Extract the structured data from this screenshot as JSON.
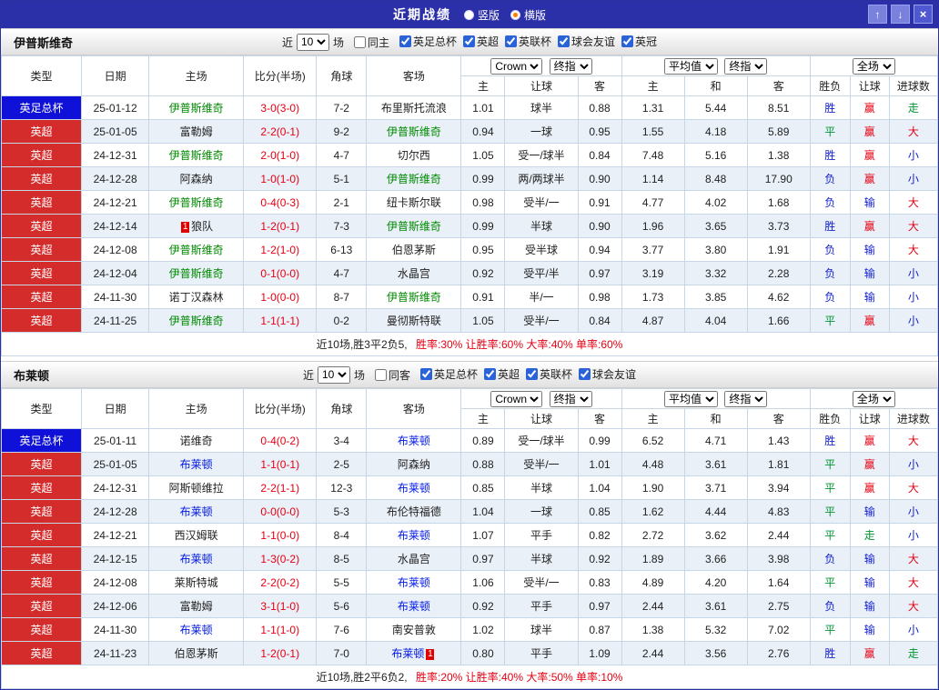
{
  "topbar": {
    "title": "近期战绩",
    "view_options": [
      {
        "label": "竖版",
        "selected": false
      },
      {
        "label": "横版",
        "selected": true
      }
    ],
    "up_icon": "↑",
    "down_icon": "↓",
    "close_icon": "×"
  },
  "labels": {
    "near": "近",
    "games": "场"
  },
  "table_header": {
    "left_cols": [
      "类型",
      "日期",
      "主场",
      "比分(半场)",
      "角球",
      "客场"
    ],
    "bookmaker": "Crown",
    "odds_type": "终指",
    "euro_source": "平均值",
    "euro_odds_type": "终指",
    "scope": "全场",
    "asia_sub": [
      "主",
      "让球",
      "客"
    ],
    "euro_sub": [
      "主",
      "和",
      "客"
    ],
    "result_sub": [
      "胜负",
      "让球",
      "进球数"
    ]
  },
  "colors": {
    "cup_badge": "#0f10d8",
    "league_badge": "#d42b2b",
    "red": "#e60012",
    "blue": "#1421cf",
    "green": "#009532"
  },
  "sections": [
    {
      "team": "伊普斯维奇",
      "team_color": "#008a00",
      "filter": {
        "count": "10",
        "same_label": "同主",
        "same_checked": false,
        "competitions": [
          "英足总杯",
          "英超",
          "英联杯",
          "球会友谊",
          "英冠"
        ]
      },
      "rows": [
        {
          "type": "英足总杯",
          "type_style": "cup",
          "date": "25-01-12",
          "home": "伊普斯维奇",
          "home_hl": true,
          "score": "3-0(3-0)",
          "corner": "7-2",
          "away": "布里斯托流浪",
          "away_hl": false,
          "red_card": null,
          "asia": [
            "1.01",
            "球半",
            "0.88"
          ],
          "euro": [
            "1.31",
            "5.44",
            "8.51"
          ],
          "result": [
            [
              "胜",
              "blue"
            ],
            [
              "赢",
              "red"
            ],
            [
              "走",
              "green"
            ]
          ]
        },
        {
          "type": "英超",
          "type_style": "league",
          "date": "25-01-05",
          "home": "富勒姆",
          "home_hl": false,
          "score": "2-2(0-1)",
          "corner": "9-2",
          "away": "伊普斯维奇",
          "away_hl": true,
          "red_card": null,
          "asia": [
            "0.94",
            "一球",
            "0.95"
          ],
          "euro": [
            "1.55",
            "4.18",
            "5.89"
          ],
          "result": [
            [
              "平",
              "green"
            ],
            [
              "赢",
              "red"
            ],
            [
              "大",
              "red"
            ]
          ]
        },
        {
          "type": "英超",
          "type_style": "league",
          "date": "24-12-31",
          "home": "伊普斯维奇",
          "home_hl": true,
          "score": "2-0(1-0)",
          "corner": "4-7",
          "away": "切尔西",
          "away_hl": false,
          "red_card": null,
          "asia": [
            "1.05",
            "受一/球半",
            "0.84"
          ],
          "euro": [
            "7.48",
            "5.16",
            "1.38"
          ],
          "result": [
            [
              "胜",
              "blue"
            ],
            [
              "赢",
              "red"
            ],
            [
              "小",
              "blue"
            ]
          ]
        },
        {
          "type": "英超",
          "type_style": "league",
          "date": "24-12-28",
          "home": "阿森纳",
          "home_hl": false,
          "score": "1-0(1-0)",
          "corner": "5-1",
          "away": "伊普斯维奇",
          "away_hl": true,
          "red_card": null,
          "asia": [
            "0.99",
            "两/两球半",
            "0.90"
          ],
          "euro": [
            "1.14",
            "8.48",
            "17.90"
          ],
          "result": [
            [
              "负",
              "blue"
            ],
            [
              "赢",
              "red"
            ],
            [
              "小",
              "blue"
            ]
          ]
        },
        {
          "type": "英超",
          "type_style": "league",
          "date": "24-12-21",
          "home": "伊普斯维奇",
          "home_hl": true,
          "score": "0-4(0-3)",
          "corner": "2-1",
          "away": "纽卡斯尔联",
          "away_hl": false,
          "red_card": null,
          "asia": [
            "0.98",
            "受半/一",
            "0.91"
          ],
          "euro": [
            "4.77",
            "4.02",
            "1.68"
          ],
          "result": [
            [
              "负",
              "blue"
            ],
            [
              "输",
              "blue"
            ],
            [
              "大",
              "red"
            ]
          ]
        },
        {
          "type": "英超",
          "type_style": "league",
          "date": "24-12-14",
          "home": "狼队",
          "home_hl": false,
          "score": "1-2(0-1)",
          "corner": "7-3",
          "away": "伊普斯维奇",
          "away_hl": true,
          "red_card": {
            "side": "home",
            "count": "1"
          },
          "asia": [
            "0.99",
            "半球",
            "0.90"
          ],
          "euro": [
            "1.96",
            "3.65",
            "3.73"
          ],
          "result": [
            [
              "胜",
              "blue"
            ],
            [
              "赢",
              "red"
            ],
            [
              "大",
              "red"
            ]
          ]
        },
        {
          "type": "英超",
          "type_style": "league",
          "date": "24-12-08",
          "home": "伊普斯维奇",
          "home_hl": true,
          "score": "1-2(1-0)",
          "corner": "6-13",
          "away": "伯恩茅斯",
          "away_hl": false,
          "red_card": null,
          "asia": [
            "0.95",
            "受半球",
            "0.94"
          ],
          "euro": [
            "3.77",
            "3.80",
            "1.91"
          ],
          "result": [
            [
              "负",
              "blue"
            ],
            [
              "输",
              "blue"
            ],
            [
              "大",
              "red"
            ]
          ]
        },
        {
          "type": "英超",
          "type_style": "league",
          "date": "24-12-04",
          "home": "伊普斯维奇",
          "home_hl": true,
          "score": "0-1(0-0)",
          "corner": "4-7",
          "away": "水晶宫",
          "away_hl": false,
          "red_card": null,
          "asia": [
            "0.92",
            "受平/半",
            "0.97"
          ],
          "euro": [
            "3.19",
            "3.32",
            "2.28"
          ],
          "result": [
            [
              "负",
              "blue"
            ],
            [
              "输",
              "blue"
            ],
            [
              "小",
              "blue"
            ]
          ]
        },
        {
          "type": "英超",
          "type_style": "league",
          "date": "24-11-30",
          "home": "诺丁汉森林",
          "home_hl": false,
          "score": "1-0(0-0)",
          "corner": "8-7",
          "away": "伊普斯维奇",
          "away_hl": true,
          "red_card": null,
          "asia": [
            "0.91",
            "半/一",
            "0.98"
          ],
          "euro": [
            "1.73",
            "3.85",
            "4.62"
          ],
          "result": [
            [
              "负",
              "blue"
            ],
            [
              "输",
              "blue"
            ],
            [
              "小",
              "blue"
            ]
          ]
        },
        {
          "type": "英超",
          "type_style": "league",
          "date": "24-11-25",
          "home": "伊普斯维奇",
          "home_hl": true,
          "score": "1-1(1-1)",
          "corner": "0-2",
          "away": "曼彻斯特联",
          "away_hl": false,
          "red_card": null,
          "asia": [
            "1.05",
            "受半/一",
            "0.84"
          ],
          "euro": [
            "4.87",
            "4.04",
            "1.66"
          ],
          "result": [
            [
              "平",
              "green"
            ],
            [
              "赢",
              "red"
            ],
            [
              "小",
              "blue"
            ]
          ]
        }
      ],
      "summary": {
        "record": "近10场,胜3平2负5,",
        "rates": "胜率:30% 让胜率:60% 大率:40% 单率:60%"
      }
    },
    {
      "team": "布莱顿",
      "team_color": "#0017e6",
      "filter": {
        "count": "10",
        "same_label": "同客",
        "same_checked": false,
        "competitions": [
          "英足总杯",
          "英超",
          "英联杯",
          "球会友谊"
        ]
      },
      "rows": [
        {
          "type": "英足总杯",
          "type_style": "cup",
          "date": "25-01-11",
          "home": "诺维奇",
          "home_hl": false,
          "score": "0-4(0-2)",
          "corner": "3-4",
          "away": "布莱顿",
          "away_hl": true,
          "red_card": null,
          "asia": [
            "0.89",
            "受一/球半",
            "0.99"
          ],
          "euro": [
            "6.52",
            "4.71",
            "1.43"
          ],
          "result": [
            [
              "胜",
              "blue"
            ],
            [
              "赢",
              "red"
            ],
            [
              "大",
              "red"
            ]
          ]
        },
        {
          "type": "英超",
          "type_style": "league",
          "date": "25-01-05",
          "home": "布莱顿",
          "home_hl": true,
          "score": "1-1(0-1)",
          "corner": "2-5",
          "away": "阿森纳",
          "away_hl": false,
          "red_card": null,
          "asia": [
            "0.88",
            "受半/一",
            "1.01"
          ],
          "euro": [
            "4.48",
            "3.61",
            "1.81"
          ],
          "result": [
            [
              "平",
              "green"
            ],
            [
              "赢",
              "red"
            ],
            [
              "小",
              "blue"
            ]
          ]
        },
        {
          "type": "英超",
          "type_style": "league",
          "date": "24-12-31",
          "home": "阿斯顿维拉",
          "home_hl": false,
          "score": "2-2(1-1)",
          "corner": "12-3",
          "away": "布莱顿",
          "away_hl": true,
          "red_card": null,
          "asia": [
            "0.85",
            "半球",
            "1.04"
          ],
          "euro": [
            "1.90",
            "3.71",
            "3.94"
          ],
          "result": [
            [
              "平",
              "green"
            ],
            [
              "赢",
              "red"
            ],
            [
              "大",
              "red"
            ]
          ]
        },
        {
          "type": "英超",
          "type_style": "league",
          "date": "24-12-28",
          "home": "布莱顿",
          "home_hl": true,
          "score": "0-0(0-0)",
          "corner": "5-3",
          "away": "布伦特福德",
          "away_hl": false,
          "red_card": null,
          "asia": [
            "1.04",
            "一球",
            "0.85"
          ],
          "euro": [
            "1.62",
            "4.44",
            "4.83"
          ],
          "result": [
            [
              "平",
              "green"
            ],
            [
              "输",
              "blue"
            ],
            [
              "小",
              "blue"
            ]
          ]
        },
        {
          "type": "英超",
          "type_style": "league",
          "date": "24-12-21",
          "home": "西汉姆联",
          "home_hl": false,
          "score": "1-1(0-0)",
          "corner": "8-4",
          "away": "布莱顿",
          "away_hl": true,
          "red_card": null,
          "asia": [
            "1.07",
            "平手",
            "0.82"
          ],
          "euro": [
            "2.72",
            "3.62",
            "2.44"
          ],
          "result": [
            [
              "平",
              "green"
            ],
            [
              "走",
              "green"
            ],
            [
              "小",
              "blue"
            ]
          ]
        },
        {
          "type": "英超",
          "type_style": "league",
          "date": "24-12-15",
          "home": "布莱顿",
          "home_hl": true,
          "score": "1-3(0-2)",
          "corner": "8-5",
          "away": "水晶宫",
          "away_hl": false,
          "red_card": null,
          "asia": [
            "0.97",
            "半球",
            "0.92"
          ],
          "euro": [
            "1.89",
            "3.66",
            "3.98"
          ],
          "result": [
            [
              "负",
              "blue"
            ],
            [
              "输",
              "blue"
            ],
            [
              "大",
              "red"
            ]
          ]
        },
        {
          "type": "英超",
          "type_style": "league",
          "date": "24-12-08",
          "home": "莱斯特城",
          "home_hl": false,
          "score": "2-2(0-2)",
          "corner": "5-5",
          "away": "布莱顿",
          "away_hl": true,
          "red_card": null,
          "asia": [
            "1.06",
            "受半/一",
            "0.83"
          ],
          "euro": [
            "4.89",
            "4.20",
            "1.64"
          ],
          "result": [
            [
              "平",
              "green"
            ],
            [
              "输",
              "blue"
            ],
            [
              "大",
              "red"
            ]
          ]
        },
        {
          "type": "英超",
          "type_style": "league",
          "date": "24-12-06",
          "home": "富勒姆",
          "home_hl": false,
          "score": "3-1(1-0)",
          "corner": "5-6",
          "away": "布莱顿",
          "away_hl": true,
          "red_card": null,
          "asia": [
            "0.92",
            "平手",
            "0.97"
          ],
          "euro": [
            "2.44",
            "3.61",
            "2.75"
          ],
          "result": [
            [
              "负",
              "blue"
            ],
            [
              "输",
              "blue"
            ],
            [
              "大",
              "red"
            ]
          ]
        },
        {
          "type": "英超",
          "type_style": "league",
          "date": "24-11-30",
          "home": "布莱顿",
          "home_hl": true,
          "score": "1-1(1-0)",
          "corner": "7-6",
          "away": "南安普敦",
          "away_hl": false,
          "red_card": null,
          "asia": [
            "1.02",
            "球半",
            "0.87"
          ],
          "euro": [
            "1.38",
            "5.32",
            "7.02"
          ],
          "result": [
            [
              "平",
              "green"
            ],
            [
              "输",
              "blue"
            ],
            [
              "小",
              "blue"
            ]
          ]
        },
        {
          "type": "英超",
          "type_style": "league",
          "date": "24-11-23",
          "home": "伯恩茅斯",
          "home_hl": false,
          "score": "1-2(0-1)",
          "corner": "7-0",
          "away": "布莱顿",
          "away_hl": true,
          "red_card": {
            "side": "away",
            "count": "1"
          },
          "asia": [
            "0.80",
            "平手",
            "1.09"
          ],
          "euro": [
            "2.44",
            "3.56",
            "2.76"
          ],
          "result": [
            [
              "胜",
              "blue"
            ],
            [
              "赢",
              "red"
            ],
            [
              "走",
              "green"
            ]
          ]
        }
      ],
      "summary": {
        "record": "近10场,胜2平6负2,",
        "rates": "胜率:20% 让胜率:40% 大率:50% 单率:10%"
      }
    }
  ]
}
